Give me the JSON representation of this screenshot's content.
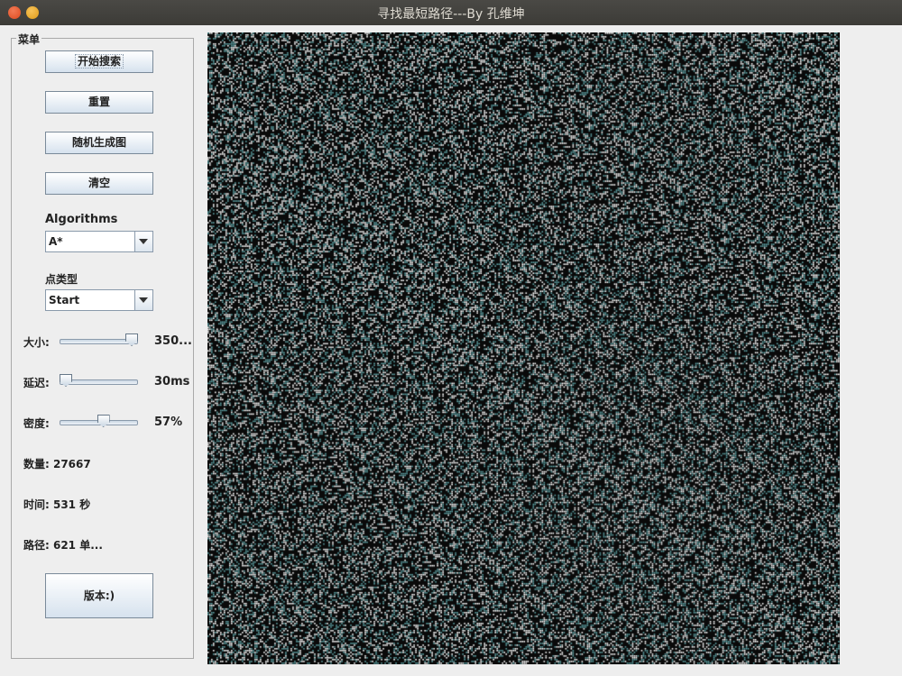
{
  "window": {
    "title": "寻找最短路径---By 孔维坤"
  },
  "menu": {
    "legend": "菜单",
    "buttons": {
      "start_search": "开始搜索",
      "reset": "重置",
      "random_generate": "随机生成图",
      "clear": "清空",
      "version": "版本:)"
    },
    "algorithms": {
      "label": "Algorithms",
      "selected": "A*"
    },
    "point_type": {
      "label": "点类型",
      "selected": "Start"
    },
    "sliders": [
      {
        "label": "大小:",
        "value_text": "350...",
        "fraction": 1.0
      },
      {
        "label": "延迟:",
        "value_text": "30ms",
        "fraction": 0.0
      },
      {
        "label": "密度:",
        "value_text": "57%",
        "fraction": 0.57
      }
    ],
    "stats": {
      "count": "数量: 27667",
      "time": "时间: 531 秒",
      "path": "路径: 621 单..."
    }
  },
  "grid": {
    "size": 350,
    "density": 0.57,
    "wall_color": "#0a0a0a",
    "open_color": "#ffffff",
    "visited_color": "#5fa3a6"
  },
  "colors": {
    "accent": "#d6e2ee",
    "titlebar": "#3c3b37"
  }
}
